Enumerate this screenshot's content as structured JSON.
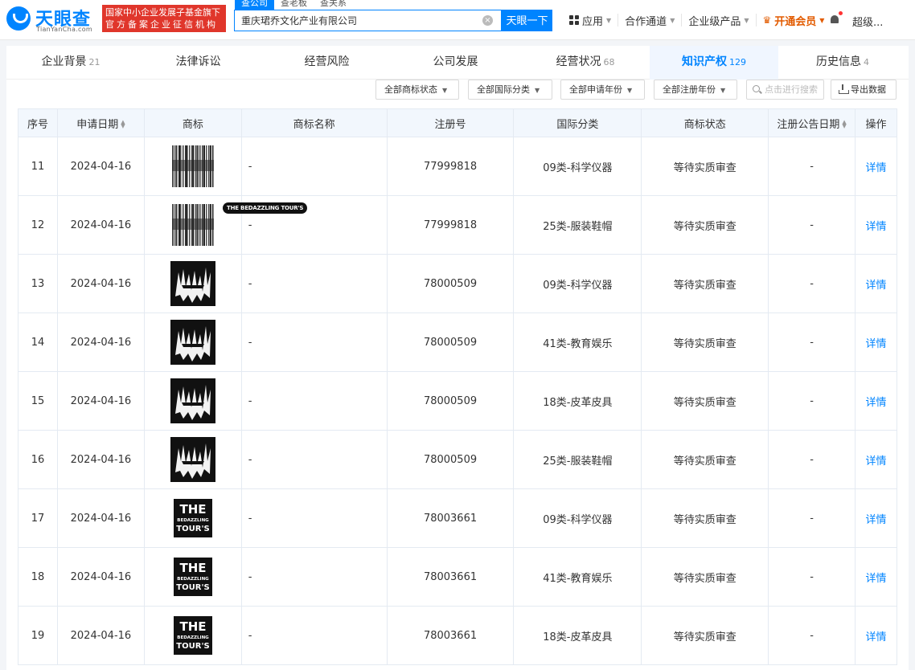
{
  "header": {
    "logo_cn": "天眼查",
    "logo_en": "TianYanCha.com",
    "badge_line1": "国家中小企业发展子基金旗下",
    "badge_line2": "官方备案企业征信机构",
    "search_tabs": [
      "查公司",
      "查老板",
      "查关系"
    ],
    "search_value": "重庆珺乔文化产业有限公司",
    "search_button": "天眼一下",
    "nav": {
      "apps": "应用",
      "cooperation": "合作通道",
      "enterprise": "企业级产品",
      "vip": "开通会员",
      "user": "超级..."
    }
  },
  "tabs": [
    {
      "label": "企业背景",
      "count": "21"
    },
    {
      "label": "法律诉讼",
      "count": ""
    },
    {
      "label": "经营风险",
      "count": ""
    },
    {
      "label": "公司发展",
      "count": ""
    },
    {
      "label": "经营状况",
      "count": "68"
    },
    {
      "label": "知识产权",
      "count": "129"
    },
    {
      "label": "历史信息",
      "count": "4"
    }
  ],
  "filters": {
    "status": "全部商标状态",
    "intl_class": "全部国际分类",
    "apply_year": "全部申请年份",
    "reg_year": "全部注册年份",
    "search_placeholder": "点击进行搜索",
    "export": "导出数据"
  },
  "table": {
    "headers": {
      "index": "序号",
      "apply_date": "申请日期",
      "trademark": "商标",
      "name": "商标名称",
      "reg_no": "注册号",
      "intl_class": "国际分类",
      "status": "商标状态",
      "announce_date": "注册公告日期",
      "action": "操作"
    },
    "rows": [
      {
        "index": "11",
        "date": "2024-04-16",
        "logo": "bars-logo",
        "name": "-",
        "reg_no": "77999818",
        "cls": "09类-科学仪器",
        "status": "等待实质审查",
        "announce": "-",
        "action": "详情"
      },
      {
        "index": "12",
        "date": "2024-04-16",
        "logo": "bars-logo",
        "name": "-",
        "reg_no": "77999818",
        "cls": "25类-服装鞋帽",
        "status": "等待实质审查",
        "announce": "-",
        "action": "详情"
      },
      {
        "index": "13",
        "date": "2024-04-16",
        "logo": "spiky-logo",
        "name": "-",
        "reg_no": "78000509",
        "cls": "09类-科学仪器",
        "status": "等待实质审查",
        "announce": "-",
        "action": "详情"
      },
      {
        "index": "14",
        "date": "2024-04-16",
        "logo": "spiky-logo",
        "name": "-",
        "reg_no": "78000509",
        "cls": "41类-教育娱乐",
        "status": "等待实质审查",
        "announce": "-",
        "action": "详情"
      },
      {
        "index": "15",
        "date": "2024-04-16",
        "logo": "spiky-logo",
        "name": "-",
        "reg_no": "78000509",
        "cls": "18类-皮革皮具",
        "status": "等待实质审查",
        "announce": "-",
        "action": "详情"
      },
      {
        "index": "16",
        "date": "2024-04-16",
        "logo": "spiky-logo",
        "name": "-",
        "reg_no": "78000509",
        "cls": "25类-服装鞋帽",
        "status": "等待实质审查",
        "announce": "-",
        "action": "详情"
      },
      {
        "index": "17",
        "date": "2024-04-16",
        "logo": "text-logo",
        "name": "-",
        "reg_no": "78003661",
        "cls": "09类-科学仪器",
        "status": "等待实质审查",
        "announce": "-",
        "action": "详情"
      },
      {
        "index": "18",
        "date": "2024-04-16",
        "logo": "text-logo",
        "name": "-",
        "reg_no": "78003661",
        "cls": "41类-教育娱乐",
        "status": "等待实质审查",
        "announce": "-",
        "action": "详情"
      },
      {
        "index": "19",
        "date": "2024-04-16",
        "logo": "text-logo",
        "name": "-",
        "reg_no": "78003661",
        "cls": "18类-皮革皮具",
        "status": "等待实质审查",
        "announce": "-",
        "action": "详情"
      }
    ]
  },
  "tooltip": "THE BEDAZZLING TOUR'S",
  "text_logo": {
    "line1": "THE",
    "line2": "BEDAZZLING",
    "line3": "TOUR'S"
  }
}
